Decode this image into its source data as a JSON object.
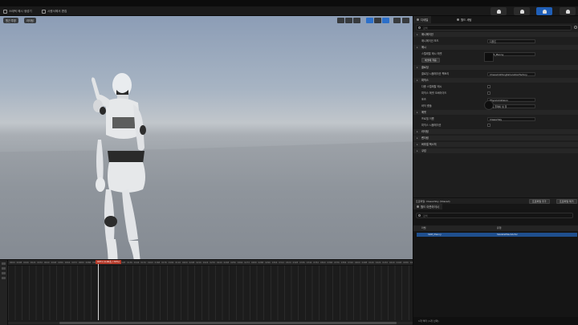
{
  "toolbar": {
    "left_items": [
      "스태틱 메시 생성기",
      "시퀀서에서 편집"
    ],
    "right_icons": [
      "person-icon",
      "person-icon",
      "run-icon",
      "settings-icon"
    ],
    "active_right_index": 2
  },
  "viewport": {
    "perspective_label": "원근 투영",
    "lit_label": "라이팅",
    "grid_value": "10",
    "rotation_value": "10°",
    "scale_value": "0.25"
  },
  "timeline": {
    "playhead_label": "0071 (4.00초 / 70%)",
    "ticks": [
      "0000",
      "0008",
      "0016",
      "0024",
      "0032",
      "0040",
      "0048",
      "0056",
      "0064",
      "0072",
      "0080",
      "0088",
      "0096",
      "0104",
      "0112",
      "0120",
      "0128",
      "0136",
      "0144",
      "0152",
      "0160",
      "0168",
      "0176",
      "0184",
      "0192",
      "0200",
      "0208",
      "0216",
      "0224",
      "0232",
      "0240",
      "0248",
      "0256",
      "0264",
      "0272",
      "0280",
      "0288",
      "0296",
      "0304",
      "0312",
      "0320",
      "0328",
      "0336",
      "0344",
      "0352",
      "0360",
      "0368",
      "0376",
      "0384",
      "0392",
      "0400",
      "0408",
      "0416",
      "0424",
      "0432",
      "0440",
      "0448",
      "0456",
      "0464"
    ]
  },
  "panel": {
    "tab_details": "디테일",
    "tab_world": "월드 세팅",
    "search_placeholder": "검색",
    "rows": [
      {
        "type": "cat",
        "label": "애니메이션"
      },
      {
        "type": "prop",
        "label": "애니메이션 모드",
        "value": "디폴트"
      },
      {
        "type": "cat",
        "label": "메시"
      },
      {
        "type": "prop",
        "label": "스켈레탈 메시 에셋",
        "value": "SKM_Manny"
      },
      {
        "type": "btn",
        "label": "에셋에 적용"
      },
      {
        "type": "cat",
        "label": "클로딩"
      },
      {
        "type": "prop",
        "label": "클로딩 시뮬레이션 팩토리",
        "value": "ChaosClothingSimulationFactory"
      },
      {
        "type": "cat",
        "label": "피직스"
      },
      {
        "type": "prop",
        "label": "다중 스켈레탈 메시",
        "value": ""
      },
      {
        "type": "prop",
        "label": "피직스 에셋 오버라이드",
        "value": ""
      },
      {
        "type": "prop",
        "label": "포즈",
        "value": "PhysicsCollision"
      },
      {
        "type": "prop",
        "label": "바닥 충돌",
        "value": "게임 플레이 및 물"
      },
      {
        "type": "cat",
        "label": "에셋"
      },
      {
        "type": "prop",
        "label": "프로필 이름",
        "value": "ClassicSky"
      },
      {
        "type": "prop",
        "label": "피직스 시뮬레이션",
        "value": ""
      },
      {
        "type": "cat",
        "label": "라이팅"
      },
      {
        "type": "cat",
        "label": "렌더링"
      },
      {
        "type": "cat",
        "label": "버추얼 텍스처"
      },
      {
        "type": "cat",
        "label": "쿠킹"
      }
    ],
    "profile_label": "프로파일: ClassicSky (Shared)",
    "profile_btn_1": "프로파일 추가",
    "profile_btn_2": "프로파일 제거",
    "outliner_tab": "월드 아웃라이너",
    "outliner_header_label": "라벨",
    "outliner_header_type": "유형",
    "outliner_row": "SKM_Manny",
    "outliner_row_type": "SkeletalMeshActor",
    "status": "1개 액터 (1개 선택)"
  }
}
